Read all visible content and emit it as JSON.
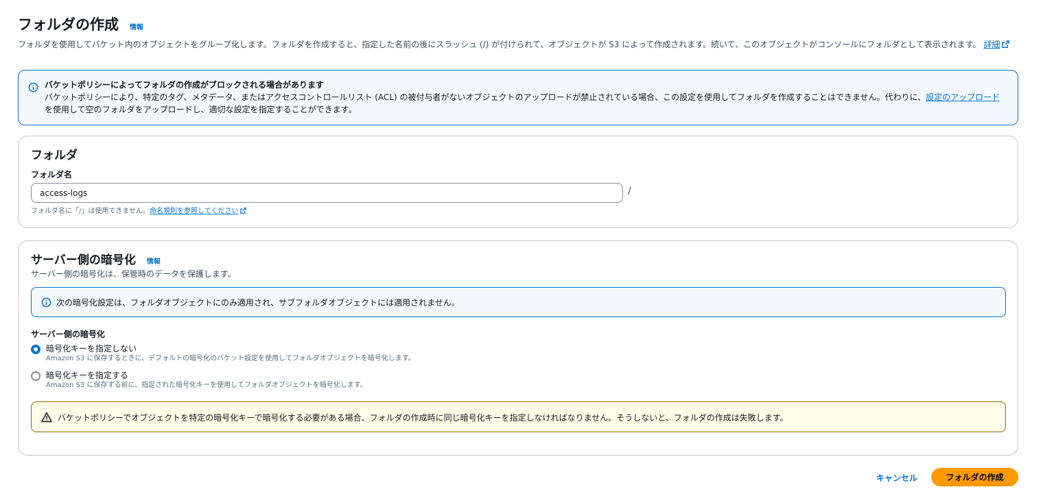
{
  "header": {
    "title": "フォルダの作成",
    "info_label": "情報",
    "description": "フォルダを使用してバケット内のオブジェクトをグループ化します。フォルダを作成すると、指定した名前の後にスラッシュ (/) が付けられて、オブジェクトが S3 によって作成されます。続いて、このオブジェクトがコンソールにフォルダとして表示されます。",
    "details_link": "詳細"
  },
  "policy_alert": {
    "title": "バケットポリシーによってフォルダの作成がブロックされる場合があります",
    "body_before": "バケットポリシーにより、特定のタグ、メタデータ、またはアクセスコントロールリスト (ACL) の被付与者がないオブジェクトのアップロードが禁止されている場合、この設定を使用してフォルダを作成することはできません。代わりに、",
    "link": "設定のアップロード",
    "body_after": "を使用して空のフォルダをアップロードし、適切な設定を指定することができます。"
  },
  "folder_section": {
    "title": "フォルダ",
    "field_label": "フォルダ名",
    "input_value": "access-logs",
    "suffix": "/",
    "constraint_text": "フォルダ名に「/」は使用できません。",
    "constraint_link": "命名規則を参照してください"
  },
  "encryption_section": {
    "title": "サーバー側の暗号化",
    "info_label": "情報",
    "description": "サーバー側の暗号化は、保管時のデータを保護します。",
    "info_text": "次の暗号化設定は、フォルダオブジェクトにのみ適用され、サブフォルダオブジェクトには適用されません。",
    "field_label": "サーバー側の暗号化",
    "options": [
      {
        "label": "暗号化キーを指定しない",
        "desc": "Amazon S3 に保存するときに、デフォルトの暗号化のバケット設定を使用してフォルダオブジェクトを暗号化します。",
        "selected": true
      },
      {
        "label": "暗号化キーを指定する",
        "desc": "Amazon S3 に保存する前に、指定された暗号化キーを使用してフォルダオブジェクトを暗号化します。",
        "selected": false
      }
    ],
    "warning_text": "バケットポリシーでオブジェクトを特定の暗号化キーで暗号化する必要がある場合、フォルダの作成時に同じ暗号化キーを指定しなければなりません。そうしないと、フォルダの作成は失敗します。"
  },
  "footer": {
    "cancel_label": "キャンセル",
    "create_label": "フォルダの作成"
  },
  "colors": {
    "link": "#0972d3",
    "primary_button": "#ff9900",
    "info_border": "#0972d3",
    "info_bg": "#f2f8fd",
    "warning_border": "#8d6605",
    "warning_bg": "#fffce9"
  }
}
